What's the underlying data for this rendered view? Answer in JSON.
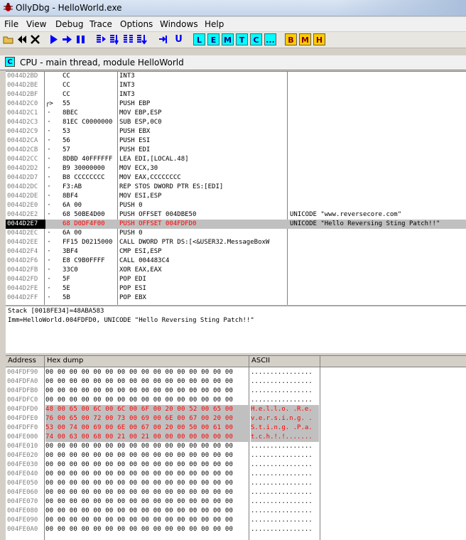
{
  "window": {
    "title": "OllyDbg - HelloWorld.exe"
  },
  "menu": [
    "File",
    "View",
    "Debug",
    "Trace",
    "Options",
    "Windows",
    "Help"
  ],
  "toolbar": {
    "nav_buttons": [
      "open-icon",
      "rewind-icon",
      "close-icon",
      "run-icon",
      "step-run-icon",
      "pause-icon",
      "step-into-icon",
      "step-over-icon",
      "animate-into-icon",
      "animate-over-icon",
      "execute-till-return-icon",
      "execute-till-user-icon"
    ],
    "window_buttons": [
      "L",
      "E",
      "M",
      "T",
      "C",
      "..."
    ],
    "extra_buttons": [
      "B",
      "M",
      "H"
    ]
  },
  "cpu_window": {
    "icon": "C",
    "title": "CPU - main thread, module HelloWorld"
  },
  "disasm": [
    {
      "addr": "0044D2BD",
      "mark": "",
      "hex": "CC",
      "asm": "INT3",
      "comment": ""
    },
    {
      "addr": "0044D2BE",
      "mark": "",
      "hex": "CC",
      "asm": "INT3",
      "comment": ""
    },
    {
      "addr": "0044D2BF",
      "mark": "",
      "hex": "CC",
      "asm": "INT3",
      "comment": ""
    },
    {
      "addr": "0044D2C0",
      "mark": "┌>",
      "hex": "55",
      "asm": "PUSH EBP",
      "comment": ""
    },
    {
      "addr": "0044D2C1",
      "mark": "·",
      "hex": "8BEC",
      "asm": "MOV EBP,ESP",
      "comment": ""
    },
    {
      "addr": "0044D2C3",
      "mark": "·",
      "hex": "81EC C0000000",
      "asm": "SUB ESP,0C0",
      "comment": ""
    },
    {
      "addr": "0044D2C9",
      "mark": "·",
      "hex": "53",
      "asm": "PUSH EBX",
      "comment": ""
    },
    {
      "addr": "0044D2CA",
      "mark": "·",
      "hex": "56",
      "asm": "PUSH ESI",
      "comment": ""
    },
    {
      "addr": "0044D2CB",
      "mark": "·",
      "hex": "57",
      "asm": "PUSH EDI",
      "comment": ""
    },
    {
      "addr": "0044D2CC",
      "mark": "·",
      "hex": "8DBD 40FFFFFF",
      "asm": "LEA EDI,[LOCAL.48]",
      "comment": ""
    },
    {
      "addr": "0044D2D2",
      "mark": "·",
      "hex": "B9 30000000",
      "asm": "MOV ECX,30",
      "comment": ""
    },
    {
      "addr": "0044D2D7",
      "mark": "·",
      "hex": "B8 CCCCCCCC",
      "asm": "MOV EAX,CCCCCCCC",
      "comment": ""
    },
    {
      "addr": "0044D2DC",
      "mark": "·",
      "hex": "F3:AB",
      "asm": "REP STOS DWORD PTR ES:[EDI]",
      "comment": ""
    },
    {
      "addr": "0044D2DE",
      "mark": "·",
      "hex": "8BF4",
      "asm": "MOV ESI,ESP",
      "comment": ""
    },
    {
      "addr": "0044D2E0",
      "mark": "·",
      "hex": "6A 00",
      "asm": "PUSH 0",
      "comment": ""
    },
    {
      "addr": "0044D2E2",
      "mark": "·",
      "hex": "68 50BE4D00",
      "asm": "PUSH OFFSET 004DBE50",
      "comment": "UNICODE \"www.reversecore.com\""
    },
    {
      "addr": "0044D2E7",
      "mark": "",
      "hex": "68 D0DF4F00",
      "asm": "PUSH OFFSET 004FDFD0",
      "comment": "UNICODE \"Hello Reversing Sting Patch!!\"",
      "selected": true,
      "red": true
    },
    {
      "addr": "0044D2EC",
      "mark": "·",
      "hex": "6A 00",
      "asm": "PUSH 0",
      "comment": ""
    },
    {
      "addr": "0044D2EE",
      "mark": "·",
      "hex": "FF15 D0215000",
      "asm": "CALL DWORD PTR DS:[<&USER32.MessageBoxW",
      "comment": ""
    },
    {
      "addr": "0044D2F4",
      "mark": "·",
      "hex": "3BF4",
      "asm": "CMP ESI,ESP",
      "comment": ""
    },
    {
      "addr": "0044D2F6",
      "mark": "·",
      "hex": "E8 C9B0FFFF",
      "asm": "CALL 004483C4",
      "comment": ""
    },
    {
      "addr": "0044D2FB",
      "mark": "·",
      "hex": "33C0",
      "asm": "XOR EAX,EAX",
      "comment": ""
    },
    {
      "addr": "0044D2FD",
      "mark": "·",
      "hex": "5F",
      "asm": "POP EDI",
      "comment": ""
    },
    {
      "addr": "0044D2FE",
      "mark": "·",
      "hex": "5E",
      "asm": "POP ESI",
      "comment": ""
    },
    {
      "addr": "0044D2FF",
      "mark": "·",
      "hex": "5B",
      "asm": "POP EBX",
      "comment": ""
    }
  ],
  "info": {
    "line1": "Stack [0018FE34]=48ABA583",
    "line2": "Imm=HelloWorld.004FDFD0, UNICODE \"Hello Reversing Sting Patch!!\""
  },
  "dump": {
    "headers": {
      "address": "Address",
      "hex": "Hex dump",
      "ascii": "ASCII"
    },
    "rows": [
      {
        "addr": "004FDF90",
        "hex": "00 00 00 00 00 00 00 00 00 00 00 00 00 00 00 00",
        "ascii": "................"
      },
      {
        "addr": "004FDFA0",
        "hex": "00 00 00 00 00 00 00 00 00 00 00 00 00 00 00 00",
        "ascii": "................"
      },
      {
        "addr": "004FDFB0",
        "hex": "00 00 00 00 00 00 00 00 00 00 00 00 00 00 00 00",
        "ascii": "................"
      },
      {
        "addr": "004FDFC0",
        "hex": "00 00 00 00 00 00 00 00 00 00 00 00 00 00 00 00",
        "ascii": "................"
      },
      {
        "addr": "004FDFD0",
        "hex": "48 00 65 00 6C 00 6C 00 6F 00 20 00 52 00 65 00",
        "ascii": "H.e.l.l.o. .R.e.",
        "hl": true
      },
      {
        "addr": "004FDFE0",
        "hex": "76 00 65 00 72 00 73 00 69 00 6E 00 67 00 20 00",
        "ascii": "v.e.r.s.i.n.g. .",
        "hl": true
      },
      {
        "addr": "004FDFF0",
        "hex": "53 00 74 00 69 00 6E 00 67 00 20 00 50 00 61 00",
        "ascii": "S.t.i.n.g. .P.a.",
        "hl": true
      },
      {
        "addr": "004FE000",
        "hex": "74 00 63 00 68 00 21 00 21 00 00 00 00 00 00 00",
        "ascii": "t.c.h.!.!.......",
        "hl": true
      },
      {
        "addr": "004FE010",
        "hex": "00 00 00 00 00 00 00 00 00 00 00 00 00 00 00 00",
        "ascii": "................"
      },
      {
        "addr": "004FE020",
        "hex": "00 00 00 00 00 00 00 00 00 00 00 00 00 00 00 00",
        "ascii": "................"
      },
      {
        "addr": "004FE030",
        "hex": "00 00 00 00 00 00 00 00 00 00 00 00 00 00 00 00",
        "ascii": "................"
      },
      {
        "addr": "004FE040",
        "hex": "00 00 00 00 00 00 00 00 00 00 00 00 00 00 00 00",
        "ascii": "................"
      },
      {
        "addr": "004FE050",
        "hex": "00 00 00 00 00 00 00 00 00 00 00 00 00 00 00 00",
        "ascii": "................"
      },
      {
        "addr": "004FE060",
        "hex": "00 00 00 00 00 00 00 00 00 00 00 00 00 00 00 00",
        "ascii": "................"
      },
      {
        "addr": "004FE070",
        "hex": "00 00 00 00 00 00 00 00 00 00 00 00 00 00 00 00",
        "ascii": "................"
      },
      {
        "addr": "004FE080",
        "hex": "00 00 00 00 00 00 00 00 00 00 00 00 00 00 00 00",
        "ascii": "................"
      },
      {
        "addr": "004FE090",
        "hex": "00 00 00 00 00 00 00 00 00 00 00 00 00 00 00 00",
        "ascii": "................"
      },
      {
        "addr": "004FE0A0",
        "hex": "00 00 00 00 00 00 00 00 00 00 00 00 00 00 00 00",
        "ascii": "................"
      }
    ]
  },
  "colors": {
    "highlight_text": "#ff0000",
    "selection": "#c0c0c0",
    "window_button": "#00ffff",
    "extra_button": "#ffcc00"
  }
}
